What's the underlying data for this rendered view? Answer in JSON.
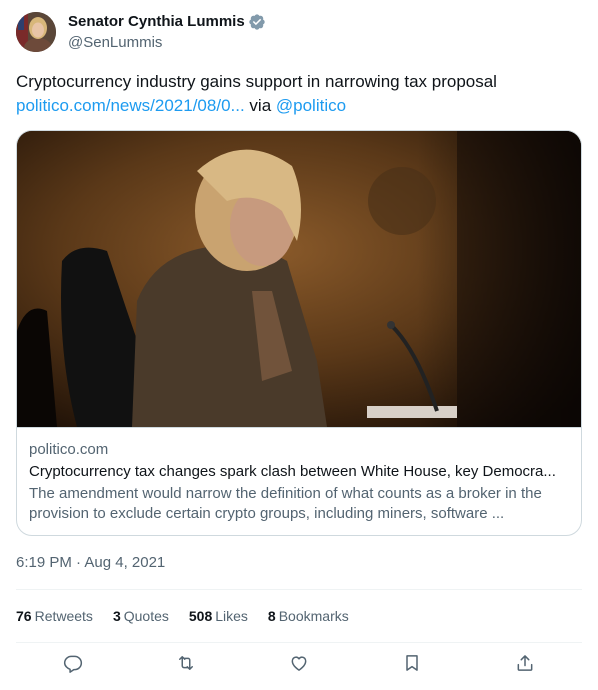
{
  "author": {
    "display_name": "Senator Cynthia Lummis",
    "handle": "@SenLummis"
  },
  "tweet": {
    "text": "Cryptocurrency industry gains support in narrowing tax proposal",
    "link_text": "politico.com/news/2021/08/0...",
    "via_text": " via ",
    "mention": "@politico"
  },
  "card": {
    "domain": "politico.com",
    "title": "Cryptocurrency tax changes spark clash between White House, key Democra...",
    "description": "The amendment would narrow the definition of what counts as a broker in the provision to exclude certain crypto groups, including miners, software ..."
  },
  "timestamp": "6:19 PM · Aug 4, 2021",
  "stats": {
    "retweets_count": "76",
    "retweets_label": "Retweets",
    "quotes_count": "3",
    "quotes_label": "Quotes",
    "likes_count": "508",
    "likes_label": "Likes",
    "bookmarks_count": "8",
    "bookmarks_label": "Bookmarks"
  },
  "icons": {
    "verified": "verified-badge-icon",
    "reply": "reply-icon",
    "retweet": "retweet-icon",
    "like": "heart-icon",
    "bookmark": "bookmark-icon",
    "share": "share-icon"
  },
  "colors": {
    "link": "#1d9bf0",
    "secondary_text": "#536471",
    "primary_text": "#0f1419",
    "border": "#cfd9de",
    "verified": "#829aab"
  }
}
